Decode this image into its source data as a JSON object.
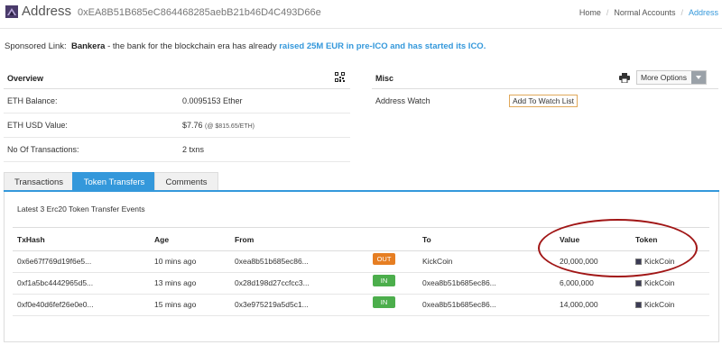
{
  "header": {
    "title": "Address",
    "address": "0xEA8B51B685eC864468285aebB21b46D4C493D66e",
    "breadcrumb": [
      "Home",
      "Normal Accounts",
      "Address"
    ]
  },
  "sponsored": {
    "label": "Sponsored Link:",
    "brand": "Bankera",
    "text": " - the bank for the blockchain era has already ",
    "highlight": "raised 25M EUR in pre-ICO and has started its ICO."
  },
  "overview": {
    "title": "Overview",
    "rows": [
      {
        "key": "ETH Balance:",
        "value": "0.0095153 Ether",
        "note": ""
      },
      {
        "key": "ETH USD Value:",
        "value": "$7.76 ",
        "note": "(@ $815.65/ETH)"
      },
      {
        "key": "No Of Transactions:",
        "value": "2 txns",
        "note": ""
      }
    ]
  },
  "misc": {
    "title": "Misc",
    "more_options": "More Options",
    "watch_label": "Address Watch",
    "watch_button": "Add To Watch List"
  },
  "tabs": [
    "Transactions",
    "Token Transfers",
    "Comments"
  ],
  "active_tab": "Token Transfers",
  "transfers": {
    "title": "Latest 3 Erc20 Token Transfer Events",
    "columns": [
      "TxHash",
      "Age",
      "From",
      "To",
      "Value",
      "Token"
    ],
    "rows": [
      {
        "hash": "0x6e67f769d19f6e5...",
        "age": "10 mins ago",
        "from": "0xea8b51b685ec86...",
        "direction": "OUT",
        "to": "KickCoin",
        "value": "20,000,000",
        "token": "KickCoin"
      },
      {
        "hash": "0xf1a5bc4442965d5...",
        "age": "13 mins ago",
        "from": "0x28d198d27ccfcc3...",
        "direction": "IN",
        "to": "0xea8b51b685ec86...",
        "value": "6,000,000",
        "token": "KickCoin"
      },
      {
        "hash": "0xf0e40d6fef26e0e0...",
        "age": "15 mins ago",
        "from": "0x3e975219a5d5c1...",
        "direction": "IN",
        "to": "0xea8b51b685ec86...",
        "value": "14,000,000",
        "token": "KickCoin"
      }
    ]
  },
  "colors": {
    "accent": "#3498db",
    "out_badge": "#e67e22",
    "in_badge": "#4cae4c",
    "annotation": "#a11616"
  }
}
